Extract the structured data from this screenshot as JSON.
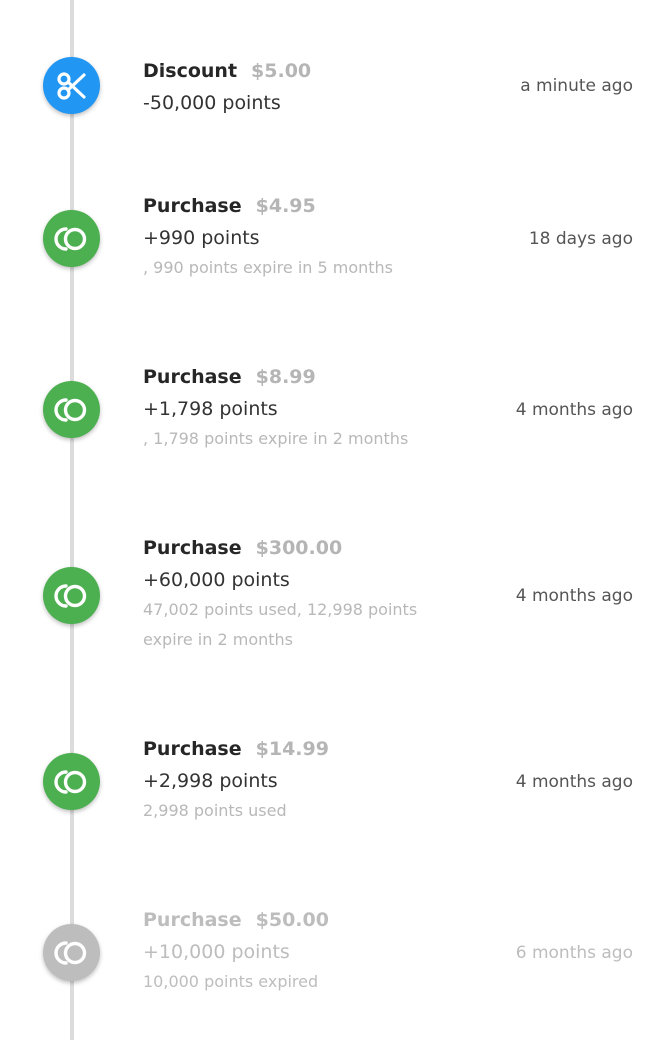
{
  "colors": {
    "discount": "#2196F3",
    "purchase": "#4CAF50",
    "expired": "#BDBDBD"
  },
  "entries": [
    {
      "type": "Discount",
      "amount": "$5.00",
      "points": "-50,000 points",
      "detail": "",
      "time": "a minute ago",
      "icon": "scissors-icon",
      "status": "discount"
    },
    {
      "type": "Purchase",
      "amount": "$4.95",
      "points": "+990 points",
      "detail": ", 990 points expire in 5 months",
      "time": "18 days ago",
      "icon": "points-coin-icon",
      "status": "active"
    },
    {
      "type": "Purchase",
      "amount": "$8.99",
      "points": "+1,798 points",
      "detail": ", 1,798 points expire in 2 months",
      "time": "4 months ago",
      "icon": "points-coin-icon",
      "status": "active"
    },
    {
      "type": "Purchase",
      "amount": "$300.00",
      "points": "+60,000 points",
      "detail": "47,002 points used, 12,998 points expire in 2 months",
      "time": "4 months ago",
      "icon": "points-coin-icon",
      "status": "active"
    },
    {
      "type": "Purchase",
      "amount": "$14.99",
      "points": "+2,998 points",
      "detail": "2,998 points used",
      "time": "4 months ago",
      "icon": "points-coin-icon",
      "status": "active"
    },
    {
      "type": "Purchase",
      "amount": "$50.00",
      "points": "+10,000 points",
      "detail": "10,000 points expired",
      "time": "6 months ago",
      "icon": "points-coin-icon",
      "status": "expired"
    }
  ]
}
